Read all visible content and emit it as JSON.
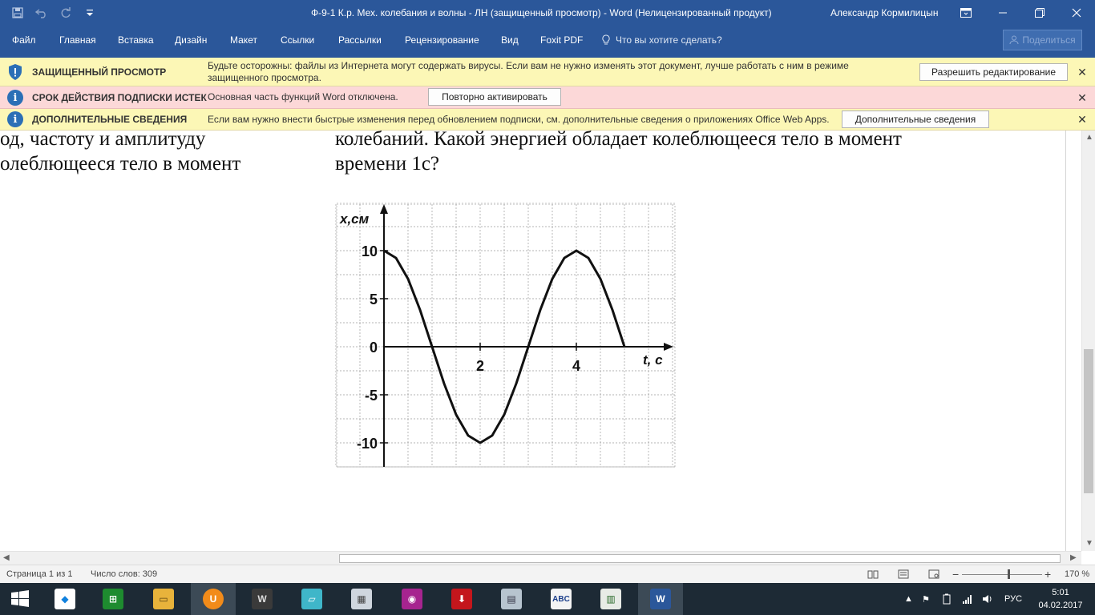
{
  "title_bar": {
    "document_title": "Ф-9-1 К.р. Мех. колебания и волны - ЛН (защищенный просмотр)  -  Word (Нелицензированный продукт)",
    "user_name": "Александр Кормилицын"
  },
  "ribbon": {
    "tabs": [
      "Файл",
      "Главная",
      "Вставка",
      "Дизайн",
      "Макет",
      "Ссылки",
      "Рассылки",
      "Рецензирование",
      "Вид",
      "Foxit PDF"
    ],
    "tell_me": "Что вы хотите сделать?",
    "share": "Поделиться"
  },
  "message_bars": {
    "protected": {
      "title": "ЗАЩИЩЕННЫЙ ПРОСМОТР",
      "text_line1": "Будьте осторожны: файлы из Интернета могут содержать вирусы. Если вам не нужно изменять этот документ, лучше работать с ним в режиме",
      "text_line2": "защищенного просмотра.",
      "button": "Разрешить редактирование"
    },
    "subscription": {
      "title": "СРОК ДЕЙСТВИЯ ПОДПИСКИ ИСТЕК",
      "text": "Основная часть функций Word отключена.",
      "button": "Повторно активировать"
    },
    "details": {
      "title": "ДОПОЛНИТЕЛЬНЫЕ СВЕДЕНИЯ",
      "text": "Если вам нужно внести быстрые изменения перед обновлением подписки, см. дополнительные сведения о приложениях Office Web Apps.",
      "button": "Дополнительные сведения"
    }
  },
  "document": {
    "left_col_line1": "од,  частоту и амплитуду",
    "left_col_line2": "олеблющееся тело в момент",
    "right_col_line1": "колебаний. Какой энергией обладает колеблющееся тело в момент",
    "right_col_line2": "времени 1с?"
  },
  "chart_data": {
    "type": "line",
    "xlabel": "t, c",
    "ylabel": "x,см",
    "x_ticks": [
      "2",
      "4"
    ],
    "y_ticks": [
      "10",
      "5",
      "0",
      "-5",
      "-10"
    ],
    "xlim": [
      0,
      6
    ],
    "ylim": [
      -12,
      13
    ],
    "series": [
      {
        "x": [
          0,
          0.25,
          0.5,
          0.75,
          1,
          1.25,
          1.5,
          1.75,
          2,
          2.25,
          2.5,
          2.75,
          3,
          3.25,
          3.5,
          3.75,
          4,
          4.25,
          4.5,
          4.75,
          5
        ],
        "values": [
          10,
          9.24,
          7.07,
          3.83,
          0,
          -3.83,
          -7.07,
          -9.24,
          -10,
          -9.24,
          -7.07,
          -3.83,
          0,
          3.83,
          7.07,
          9.24,
          10,
          9.24,
          7.07,
          3.83,
          0
        ]
      }
    ],
    "grid": true
  },
  "status_bar": {
    "page": "Страница 1 из 1",
    "words": "Число слов: 309",
    "zoom": "170 %"
  },
  "taskbar": {
    "language": "РУС",
    "time": "5:01",
    "date": "04.02.2017"
  }
}
